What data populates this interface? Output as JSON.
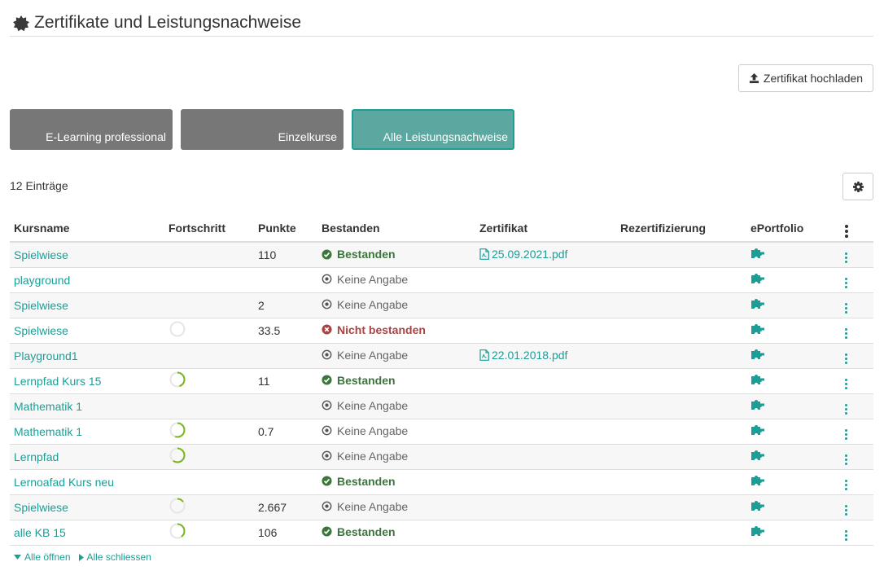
{
  "page": {
    "title": "Zertifikate und Leistungsnachweise",
    "upload_label": "Zertifikat hochladen",
    "entries_label": "12 Einträge"
  },
  "tabs": [
    {
      "label": "E-Learning professional",
      "active": false
    },
    {
      "label": "Einzelkurse",
      "active": false
    },
    {
      "label": "Alle Leistungsnachweise",
      "active": true
    }
  ],
  "table": {
    "columns": [
      "Kursname",
      "Fortschritt",
      "Punkte",
      "Bestanden",
      "Zertifikat",
      "Rezertifizierung",
      "ePortfolio"
    ],
    "rows": [
      {
        "name": "Spielwiese",
        "progress": null,
        "points": "110",
        "status": "passed",
        "status_label": "Bestanden",
        "certificate": "25.09.2021.pdf"
      },
      {
        "name": "playground",
        "progress": null,
        "points": "",
        "status": "none",
        "status_label": "Keine Angabe",
        "certificate": ""
      },
      {
        "name": "Spielwiese",
        "progress": null,
        "points": "2",
        "status": "none",
        "status_label": "Keine Angabe",
        "certificate": ""
      },
      {
        "name": "Spielwiese",
        "progress": 0,
        "points": "33.5",
        "status": "failed",
        "status_label": "Nicht bestanden",
        "certificate": ""
      },
      {
        "name": "Playground1",
        "progress": null,
        "points": "",
        "status": "none",
        "status_label": "Keine Angabe",
        "certificate": "22.01.2018.pdf"
      },
      {
        "name": "Lernpfad Kurs 15",
        "progress": 0.45,
        "points": "11",
        "status": "passed",
        "status_label": "Bestanden",
        "certificate": ""
      },
      {
        "name": "Mathematik 1",
        "progress": null,
        "points": "",
        "status": "none",
        "status_label": "Keine Angabe",
        "certificate": ""
      },
      {
        "name": "Mathematik 1",
        "progress": 0.55,
        "points": "0.7",
        "status": "none",
        "status_label": "Keine Angabe",
        "certificate": ""
      },
      {
        "name": "Lernpfad",
        "progress": 0.6,
        "points": "",
        "status": "none",
        "status_label": "Keine Angabe",
        "certificate": ""
      },
      {
        "name": "Lernoafad Kurs neu",
        "progress": null,
        "points": "",
        "status": "passed",
        "status_label": "Bestanden",
        "certificate": ""
      },
      {
        "name": "Spielwiese",
        "progress": 0.15,
        "points": "2.667",
        "status": "none",
        "status_label": "Keine Angabe",
        "certificate": ""
      },
      {
        "name": "alle KB 15",
        "progress": 0.4,
        "points": "106",
        "status": "passed",
        "status_label": "Bestanden",
        "certificate": ""
      }
    ]
  },
  "footer": {
    "open_all": "Alle öffnen",
    "close_all": "Alle schliessen"
  },
  "colors": {
    "accent": "#1c9d96",
    "passed": "#3c763d",
    "failed": "#a94442",
    "progress": "#7ab51d",
    "tab_inactive": "#777777",
    "tab_active": "#5ca8a1"
  },
  "icons": {
    "title": "badge-icon",
    "upload": "upload-icon",
    "settings": "gear-icon",
    "passed": "check-circle-icon",
    "failed": "times-circle-icon",
    "none": "dot-circle-icon",
    "certificate": "pdf-file-icon",
    "eportfolio": "puzzle-icon",
    "row_menu": "kebab-icon"
  }
}
